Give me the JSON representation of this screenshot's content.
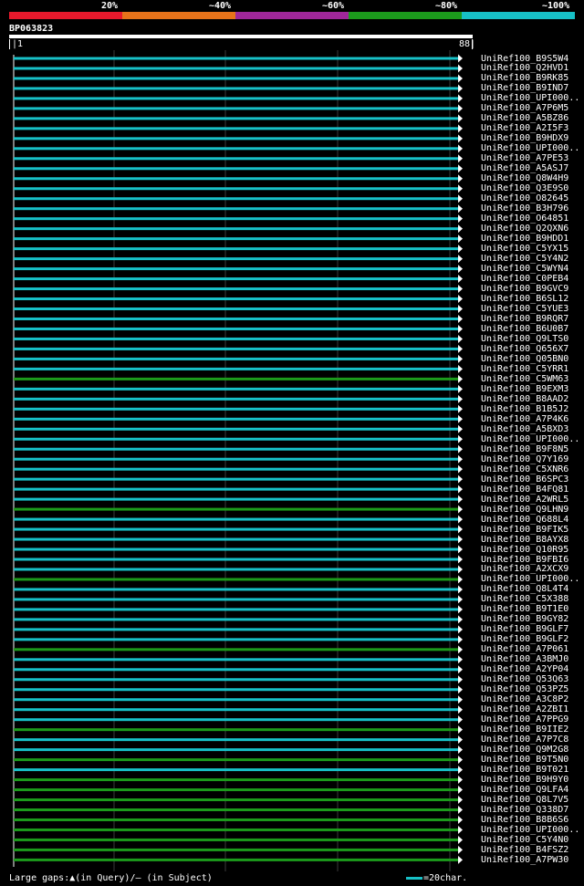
{
  "legend": {
    "labels": [
      "20%",
      "~40%",
      "~60%",
      "~80%",
      "~100%"
    ],
    "colors": [
      "#e8192c",
      "#e8731a",
      "#a0279a",
      "#1c9b1c",
      "#17c1c7"
    ]
  },
  "query": {
    "id": "BP063823",
    "start": "|1",
    "end": "88|"
  },
  "colors": {
    "cyan": "#17c1c7",
    "green": "#1c9b1c",
    "grid": "#3a3a3a",
    "arrow": "#ffffff"
  },
  "chart_data": {
    "type": "bar",
    "x_range": [
      1,
      88
    ],
    "hits": [
      {
        "name": "UniRef100_B9S5W4",
        "level": "~100%"
      },
      {
        "name": "UniRef100_Q2HVD1",
        "level": "~100%"
      },
      {
        "name": "UniRef100_B9RK85",
        "level": "~100%"
      },
      {
        "name": "UniRef100_B9IND7",
        "level": "~100%"
      },
      {
        "name": "UniRef100_UPI000..",
        "level": "~100%"
      },
      {
        "name": "UniRef100_A7P6M5",
        "level": "~100%"
      },
      {
        "name": "UniRef100_A5BZ86",
        "level": "~100%"
      },
      {
        "name": "UniRef100_A2I5F3",
        "level": "~100%"
      },
      {
        "name": "UniRef100_B9HDX9",
        "level": "~100%"
      },
      {
        "name": "UniRef100_UPI000..",
        "level": "~100%"
      },
      {
        "name": "UniRef100_A7PE53",
        "level": "~100%"
      },
      {
        "name": "UniRef100_A5ASJ7",
        "level": "~100%"
      },
      {
        "name": "UniRef100_Q8W4H9",
        "level": "~100%"
      },
      {
        "name": "UniRef100_Q3E9S0",
        "level": "~100%"
      },
      {
        "name": "UniRef100_O82645",
        "level": "~100%"
      },
      {
        "name": "UniRef100_B3H796",
        "level": "~100%"
      },
      {
        "name": "UniRef100_O64851",
        "level": "~100%"
      },
      {
        "name": "UniRef100_Q2QXN6",
        "level": "~100%"
      },
      {
        "name": "UniRef100_B9HDD1",
        "level": "~100%"
      },
      {
        "name": "UniRef100_C5YX15",
        "level": "~100%"
      },
      {
        "name": "UniRef100_C5Y4N2",
        "level": "~100%"
      },
      {
        "name": "UniRef100_C5WYN4",
        "level": "~100%"
      },
      {
        "name": "UniRef100_C0PEB4",
        "level": "~100%"
      },
      {
        "name": "UniRef100_B9GVC9",
        "level": "~100%"
      },
      {
        "name": "UniRef100_B6SL12",
        "level": "~100%"
      },
      {
        "name": "UniRef100_C5YUE3",
        "level": "~100%"
      },
      {
        "name": "UniRef100_B9RQR7",
        "level": "~100%"
      },
      {
        "name": "UniRef100_B6U0B7",
        "level": "~100%"
      },
      {
        "name": "UniRef100_Q9LTS0",
        "level": "~100%"
      },
      {
        "name": "UniRef100_Q656X7",
        "level": "~100%"
      },
      {
        "name": "UniRef100_Q05BN0",
        "level": "~100%"
      },
      {
        "name": "UniRef100_C5YRR1",
        "level": "~100%"
      },
      {
        "name": "UniRef100_C5WM63",
        "level": "~80%"
      },
      {
        "name": "UniRef100_B9EXM3",
        "level": "~100%"
      },
      {
        "name": "UniRef100_B8AAD2",
        "level": "~100%"
      },
      {
        "name": "UniRef100_B1B5J2",
        "level": "~100%"
      },
      {
        "name": "UniRef100_A7P4K6",
        "level": "~100%"
      },
      {
        "name": "UniRef100_A5BXD3",
        "level": "~100%"
      },
      {
        "name": "UniRef100_UPI000..",
        "level": "~100%"
      },
      {
        "name": "UniRef100_B9F8N5",
        "level": "~100%"
      },
      {
        "name": "UniRef100_Q7Y169",
        "level": "~100%"
      },
      {
        "name": "UniRef100_C5XNR6",
        "level": "~100%"
      },
      {
        "name": "UniRef100_B6SPC3",
        "level": "~100%"
      },
      {
        "name": "UniRef100_B4FQ81",
        "level": "~100%"
      },
      {
        "name": "UniRef100_A2WRL5",
        "level": "~100%"
      },
      {
        "name": "UniRef100_Q9LHN9",
        "level": "~80%"
      },
      {
        "name": "UniRef100_Q688L4",
        "level": "~100%"
      },
      {
        "name": "UniRef100_B9FIK5",
        "level": "~100%"
      },
      {
        "name": "UniRef100_B8AYX8",
        "level": "~100%"
      },
      {
        "name": "UniRef100_Q10R95",
        "level": "~100%"
      },
      {
        "name": "UniRef100_B9FBI6",
        "level": "~100%"
      },
      {
        "name": "UniRef100_A2XCX9",
        "level": "~100%"
      },
      {
        "name": "UniRef100_UPI000..",
        "level": "~80%"
      },
      {
        "name": "UniRef100_Q8L4T4",
        "level": "~100%"
      },
      {
        "name": "UniRef100_C5X388",
        "level": "~100%"
      },
      {
        "name": "UniRef100_B9T1E0",
        "level": "~100%"
      },
      {
        "name": "UniRef100_B9GY82",
        "level": "~100%"
      },
      {
        "name": "UniRef100_B9GLF7",
        "level": "~100%"
      },
      {
        "name": "UniRef100_B9GLF2",
        "level": "~100%"
      },
      {
        "name": "UniRef100_A7P061",
        "level": "~80%"
      },
      {
        "name": "UniRef100_A3BMJ0",
        "level": "~100%"
      },
      {
        "name": "UniRef100_A2YP04",
        "level": "~100%"
      },
      {
        "name": "UniRef100_Q53Q63",
        "level": "~100%"
      },
      {
        "name": "UniRef100_Q53PZ5",
        "level": "~100%"
      },
      {
        "name": "UniRef100_A3C8P2",
        "level": "~100%"
      },
      {
        "name": "UniRef100_A2ZBI1",
        "level": "~100%"
      },
      {
        "name": "UniRef100_A7PPG9",
        "level": "~100%"
      },
      {
        "name": "UniRef100_B9IIE2",
        "level": "~80%"
      },
      {
        "name": "UniRef100_A7P7C8",
        "level": "~100%"
      },
      {
        "name": "UniRef100_Q9M2G8",
        "level": "~100%"
      },
      {
        "name": "UniRef100_B9T5N0",
        "level": "~80%"
      },
      {
        "name": "UniRef100_B9T021",
        "level": "~100%"
      },
      {
        "name": "UniRef100_B9H9Y0",
        "level": "~80%"
      },
      {
        "name": "UniRef100_Q9LFA4",
        "level": "~80%"
      },
      {
        "name": "UniRef100_Q8L7V5",
        "level": "~80%"
      },
      {
        "name": "UniRef100_Q338D7",
        "level": "~80%"
      },
      {
        "name": "UniRef100_B8B6S6",
        "level": "~80%"
      },
      {
        "name": "UniRef100_UPI000..",
        "level": "~80%"
      },
      {
        "name": "UniRef100_C5Y4N0",
        "level": "~80%"
      },
      {
        "name": "UniRef100_B4FSZ2",
        "level": "~80%"
      },
      {
        "name": "UniRef100_A7PW30",
        "level": "~80%"
      }
    ]
  },
  "footer": {
    "gaps_text": "Large gaps:▲(in Query)/– (in Subject)",
    "scale_text": "=20char."
  }
}
